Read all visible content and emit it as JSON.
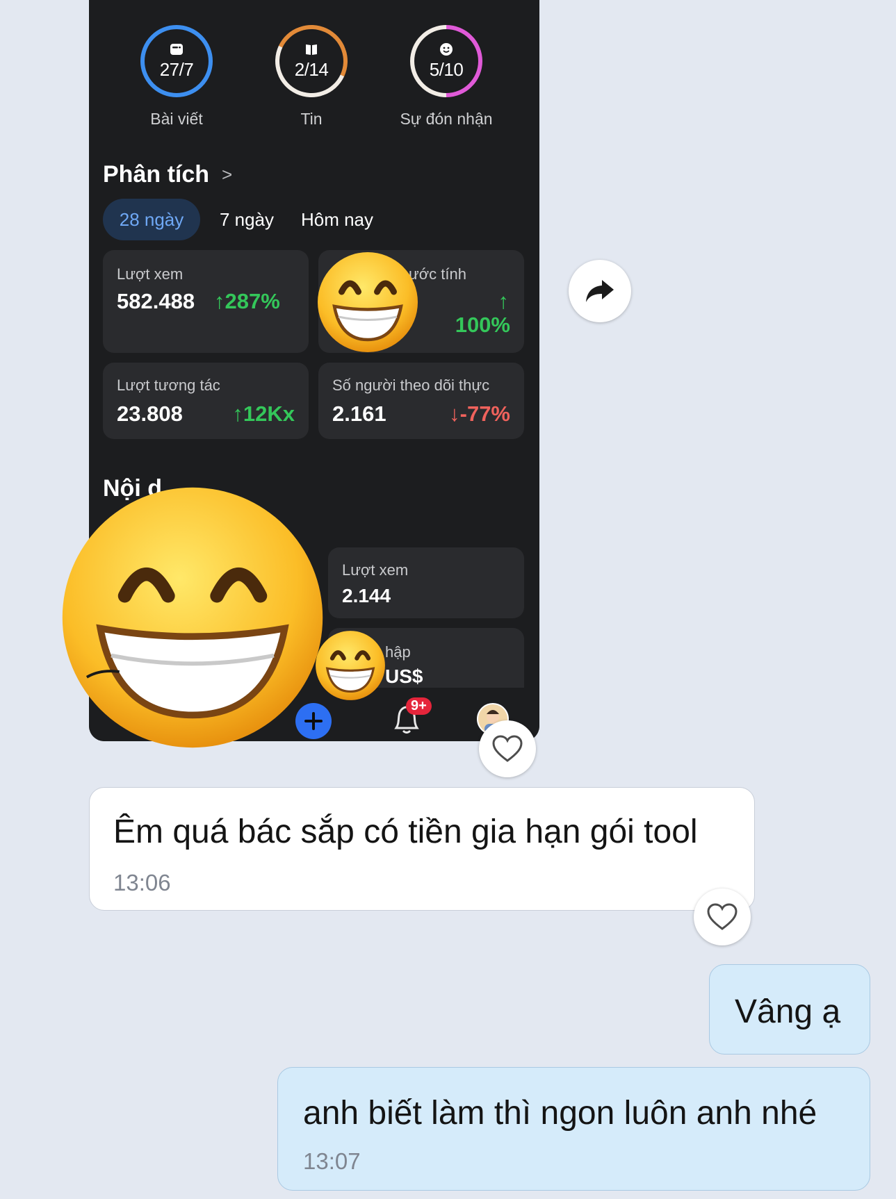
{
  "screenshot": {
    "rings": [
      {
        "value": "27/7",
        "label": "Bài viết",
        "icon": "post-icon",
        "color": "#3d8ff0",
        "progress": 1.0
      },
      {
        "value": "2/14",
        "label": "Tin",
        "icon": "book-icon",
        "color": "#e28a38",
        "progress": 0.14
      },
      {
        "value": "5/10",
        "label": "Sự đón nhận",
        "icon": "smiley-icon",
        "color": "#e05ad8",
        "progress": 0.5
      }
    ],
    "analytics": {
      "title": "Phân tích",
      "chevron": ">",
      "tabs": [
        "28 ngày",
        "7 ngày",
        "Hôm nay"
      ],
      "cards": {
        "views": {
          "label": "Lượt xem",
          "value": "582.488",
          "delta": "287%",
          "trend": "up"
        },
        "estimated": {
          "label": "ước tính",
          "value": "",
          "delta": "100%",
          "trend": "up"
        },
        "interactions": {
          "label": "Lượt tương tác",
          "value": "23.808",
          "delta": "12Kx",
          "trend": "up"
        },
        "followers": {
          "label": "Số người theo dõi thực",
          "value": "2.161",
          "delta": "-77%",
          "trend": "down"
        }
      }
    },
    "content": {
      "title_partial": "Nội d",
      "views_card": {
        "label": "Lượt xem",
        "value": "2.144"
      },
      "income_card": {
        "label_partial": "hập",
        "value_partial": "US$"
      }
    },
    "bottom_nav": {
      "notification_badge": "9+"
    }
  },
  "messages": [
    {
      "text": "Êm quá bác sắp có tiền gia hạn gói tool",
      "time": "13:06",
      "from": "other"
    },
    {
      "text": "Vâng ạ",
      "time": "",
      "from": "me"
    },
    {
      "text": "anh biết làm thì ngon luôn anh nhé",
      "time": "13:07",
      "from": "me"
    }
  ],
  "colors": {
    "page_bg": "#e3e8f1",
    "app_bg": "#1c1d1f",
    "card_bg": "#2a2b2e",
    "up": "#34c75a",
    "down": "#f0625c",
    "my_bubble": "#d5ebfa",
    "other_bubble": "#ffffff",
    "accent_blue": "#2d6ff2"
  },
  "icons": [
    "share-icon",
    "heart-icon",
    "plus-icon",
    "bell-icon",
    "avatar",
    "grinning-emoji"
  ]
}
